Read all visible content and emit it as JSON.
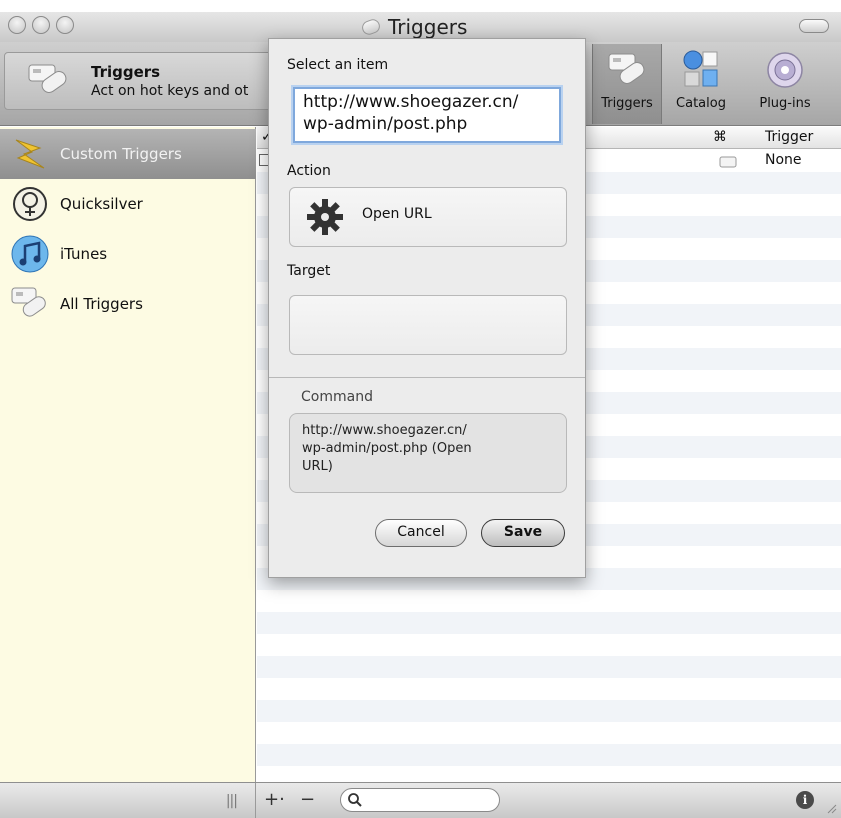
{
  "window": {
    "title": "Triggers"
  },
  "header": {
    "title": "Triggers",
    "subtitle": "Act on hot keys and ot"
  },
  "toolbar": {
    "items": [
      {
        "label": "Triggers",
        "icon": "triggers-icon",
        "selected": true
      },
      {
        "label": "Catalog",
        "icon": "catalog-icon",
        "selected": false
      },
      {
        "label": "Plug-ins",
        "icon": "plugins-icon",
        "selected": false
      }
    ]
  },
  "sidebar": {
    "items": [
      {
        "label": "Custom Triggers",
        "icon": "lightning-icon",
        "selected": true
      },
      {
        "label": "Quicksilver",
        "icon": "quicksilver-icon",
        "selected": false
      },
      {
        "label": "iTunes",
        "icon": "itunes-icon",
        "selected": false
      },
      {
        "label": "All Triggers",
        "icon": "triggers-icon",
        "selected": false
      }
    ]
  },
  "table": {
    "columns": {
      "check": "✓",
      "cmd": "⌘",
      "trigger": "Trigger"
    },
    "rows": [
      {
        "trigger": "None"
      }
    ]
  },
  "sheet": {
    "select_label": "Select an item",
    "item_value_line1": "http://www.shoegazer.cn/",
    "item_value_line2": "wp-admin/post.php",
    "action_label": "Action",
    "action_value": "Open URL",
    "target_label": "Target",
    "command_label": "Command",
    "command_line1": "http://www.shoegazer.cn/",
    "command_line2": "wp-admin/post.php (Open",
    "command_line3": "URL)",
    "cancel_label": "Cancel",
    "save_label": "Save"
  },
  "bottombar": {
    "grip": "|||",
    "add_label": "+·",
    "remove_label": "−",
    "search_icon": "magnifier-icon",
    "info_label": "i"
  },
  "colors": {
    "sidebar_bg": "#fdfbe3",
    "selection_gray": "#9e9e9e",
    "focus_blue": "#7fa8dc"
  }
}
